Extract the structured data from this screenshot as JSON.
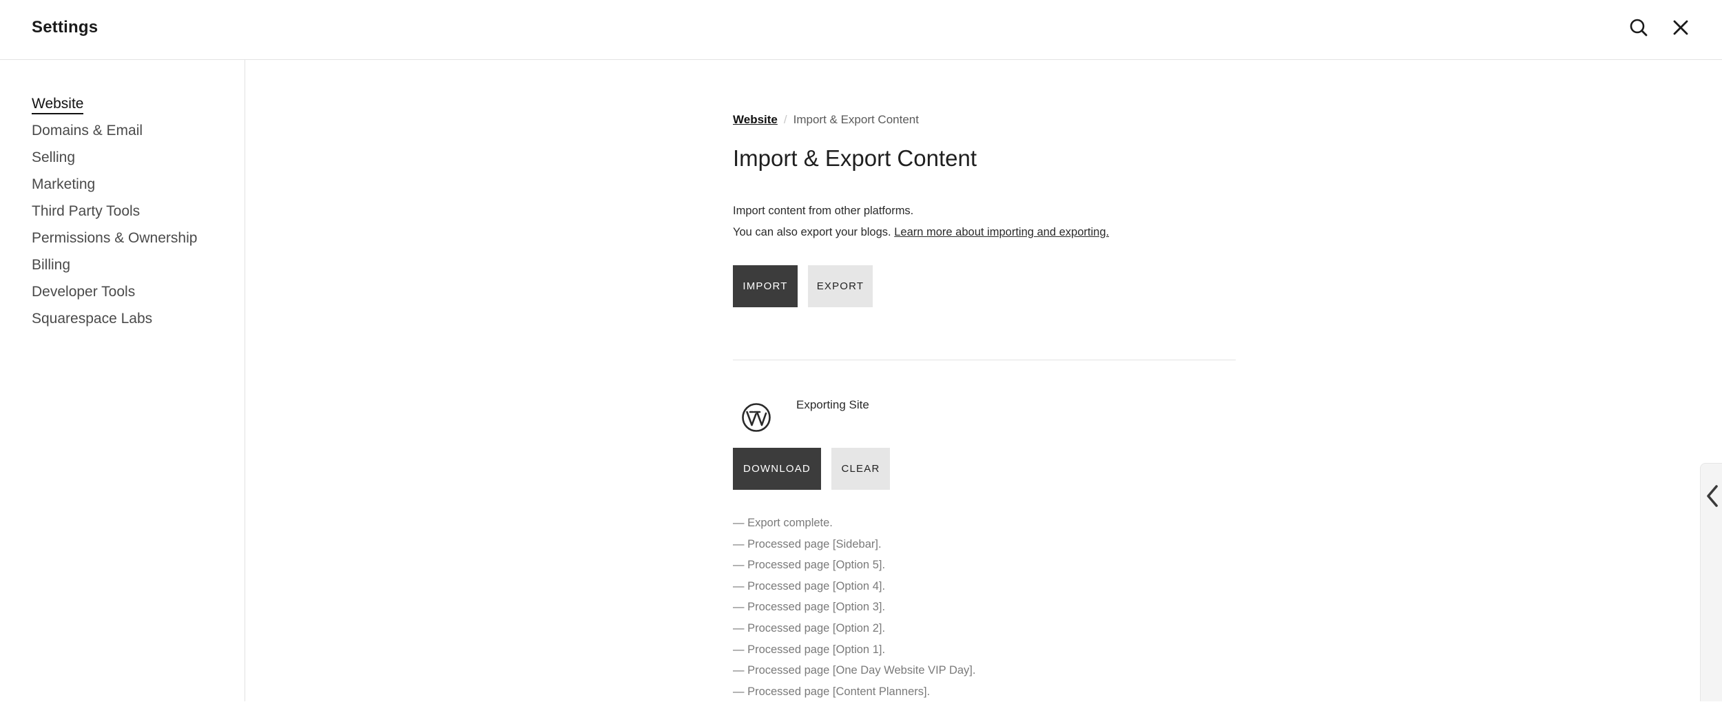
{
  "header": {
    "title": "Settings",
    "search_icon": "search-icon",
    "close_icon": "close-icon"
  },
  "sidebar": {
    "items": [
      {
        "label": "Website",
        "active": true
      },
      {
        "label": "Domains & Email"
      },
      {
        "label": "Selling"
      },
      {
        "label": "Marketing"
      },
      {
        "label": "Third Party Tools"
      },
      {
        "label": "Permissions & Ownership"
      },
      {
        "label": "Billing"
      },
      {
        "label": "Developer Tools"
      },
      {
        "label": "Squarespace Labs"
      }
    ]
  },
  "breadcrumb": {
    "parent": "Website",
    "separator": "/",
    "current": "Import & Export Content"
  },
  "main": {
    "title": "Import & Export Content",
    "description_line1": "Import content from other platforms.",
    "description_line2": "You can also export your blogs.",
    "learn_more_link": "Learn more about importing and exporting.",
    "import_button": "IMPORT",
    "export_button": "EXPORT"
  },
  "export_task": {
    "icon": "wordpress-icon",
    "label": "Exporting Site",
    "download_button": "DOWNLOAD",
    "clear_button": "CLEAR",
    "log": [
      "— Export complete.",
      "— Processed page [Sidebar].",
      "— Processed page [Option 5].",
      "— Processed page [Option 4].",
      "— Processed page [Option 3].",
      "— Processed page [Option 2].",
      "— Processed page [Option 1].",
      "— Processed page [One Day Website VIP Day].",
      "— Processed page [Content Planners]."
    ]
  },
  "side_panel": {
    "icon": "chevron-left-icon"
  },
  "colors": {
    "dark_button": "#3c3c3c",
    "light_button": "#e6e6e6",
    "border": "#e2e2e2",
    "log_text": "#7a7a7a"
  }
}
